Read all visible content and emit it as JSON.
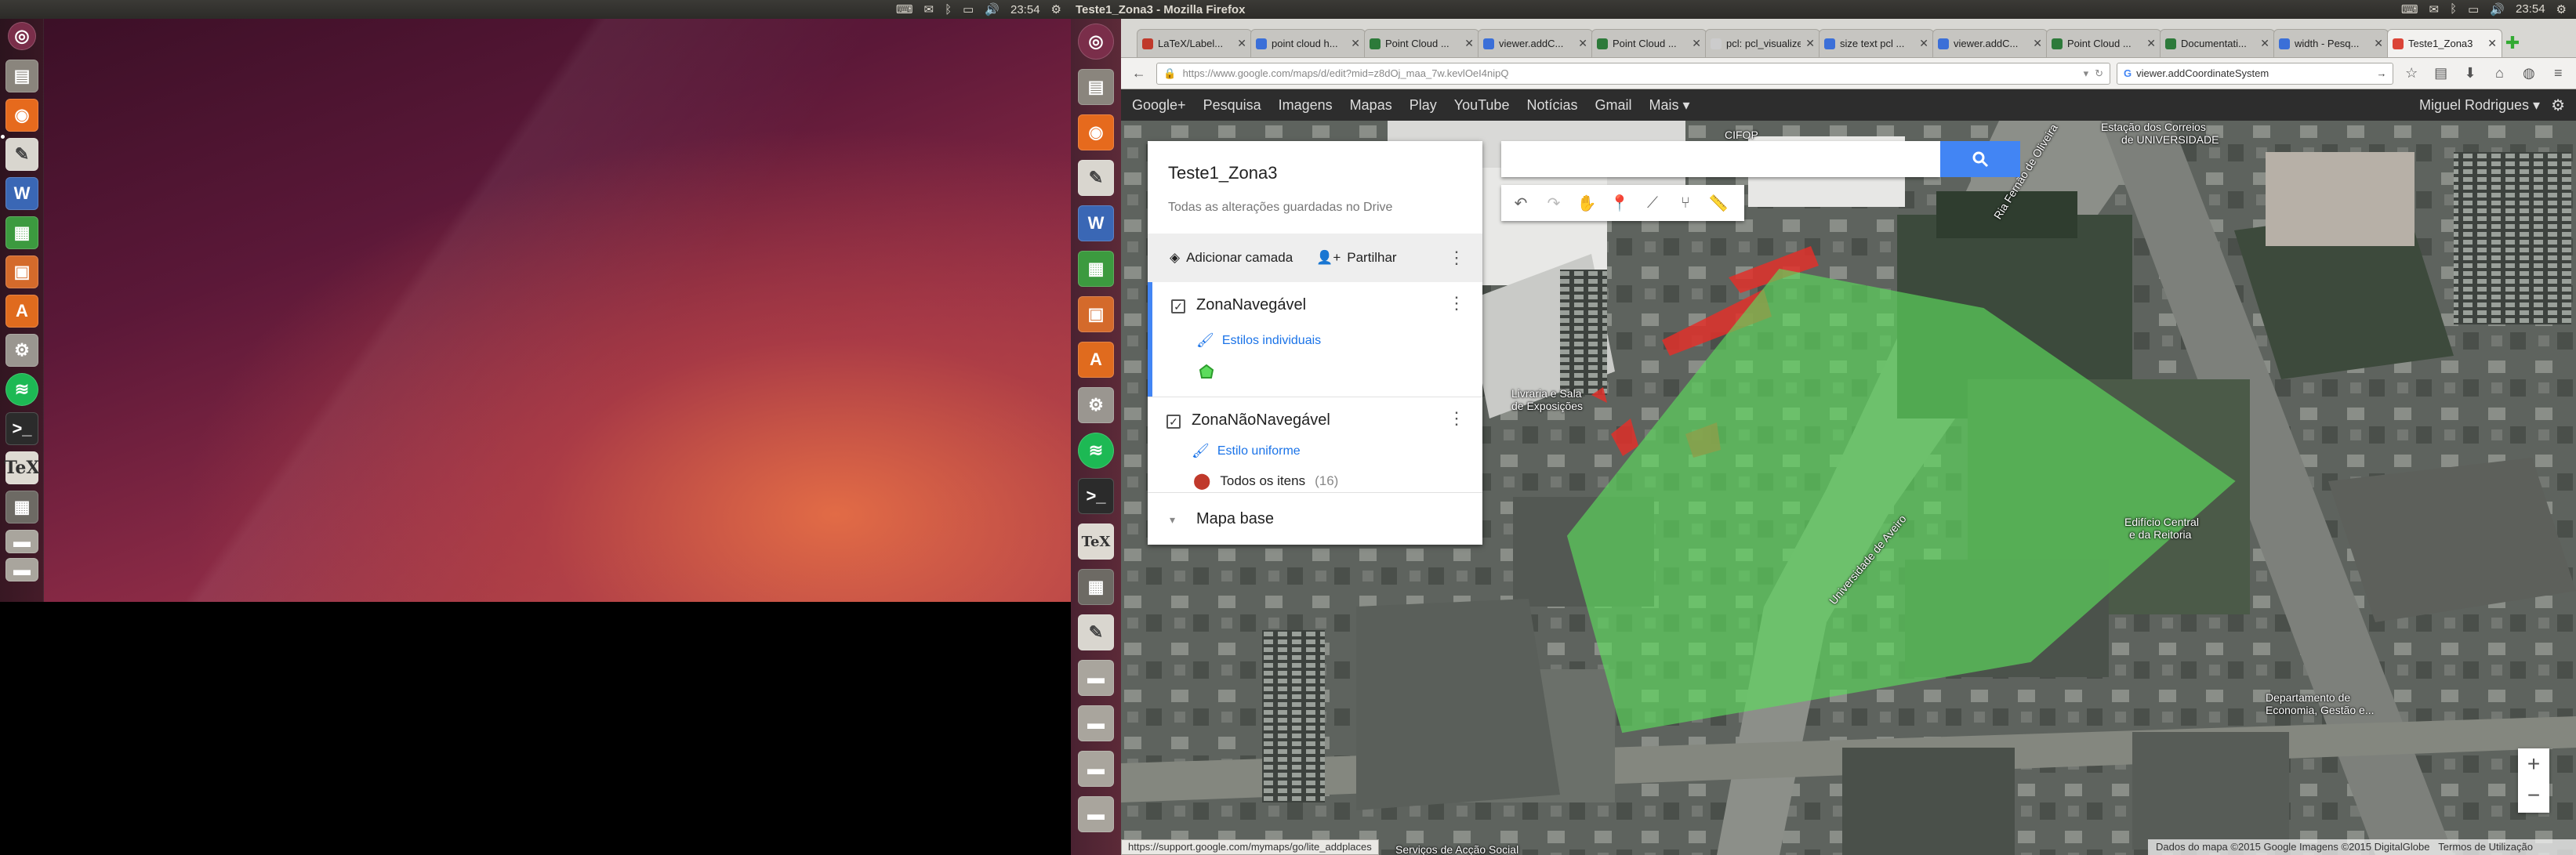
{
  "left_screen": {
    "clock": "23:54"
  },
  "right_screen": {
    "window_title": "Teste1_Zona3 - Mozilla Firefox",
    "clock": "23:54"
  },
  "tabs": [
    {
      "label": "LaTeX/Label...",
      "icon_color": "#c0392b"
    },
    {
      "label": "point cloud h...",
      "icon_color": "#3b6fd8"
    },
    {
      "label": "Point Cloud ...",
      "icon_color": "#2d7a3a"
    },
    {
      "label": "viewer.addC...",
      "icon_color": "#3b6fd8"
    },
    {
      "label": "Point Cloud ...",
      "icon_color": "#2d7a3a"
    },
    {
      "label": "pcl: pcl_visualize...",
      "icon_color": "#cccccc"
    },
    {
      "label": "size text pcl ...",
      "icon_color": "#3b6fd8"
    },
    {
      "label": "viewer.addC...",
      "icon_color": "#3b6fd8"
    },
    {
      "label": "Point Cloud ...",
      "icon_color": "#2d7a3a"
    },
    {
      "label": "Documentati...",
      "icon_color": "#2d7a3a"
    },
    {
      "label": "width - Pesq...",
      "icon_color": "#3b6fd8"
    },
    {
      "label": "Teste1_Zona3",
      "icon_color": "#db4437"
    }
  ],
  "navbar": {
    "url": "https://www.google.com/maps/d/edit?mid=z8dOj_maa_7w.kevlOeI4nipQ",
    "search": "viewer.addCoordinateSystem"
  },
  "google_bar": {
    "links": [
      "Google+",
      "Pesquisa",
      "Imagens",
      "Mapas",
      "Play",
      "YouTube",
      "Notícias",
      "Gmail",
      "Mais ▾"
    ],
    "user": "Miguel Rodrigues ▾"
  },
  "panel": {
    "title": "Teste1_Zona3",
    "subtitle": "Todas as alterações guardadas no Drive",
    "add_layer": "Adicionar camada",
    "share": "Partilhar",
    "layer1": {
      "name": "ZonaNavegável",
      "style": "Estilos individuais"
    },
    "layer2": {
      "name": "ZonaNãoNavegável",
      "style": "Estilo uniforme",
      "items_label": "Todos os itens",
      "items_count": "(16)"
    },
    "basemap": "Mapa base"
  },
  "map": {
    "labels": [
      "CIFOP",
      "Estação dos Correios",
      "de UNIVERSIDADE",
      "Livraria e Sala",
      "de Exposições",
      "Edifício Central",
      "e da Reitoria",
      "Universidade de Aveiro",
      "Departamento de",
      "Economia, Gestão e...",
      "Serviços de Acção Social",
      "Ria Fernão de Oliveira"
    ],
    "footer_data": "Dados do mapa ©2015 Google Imagens ©2015 DigitalGlobe",
    "footer_terms": "Termos de Utilização",
    "zoom_in": "+",
    "zoom_out": "−"
  },
  "status_url": "https://support.google.com/mymaps/go/lite_addplaces",
  "colors": {
    "navigable_polygon": "#5ddc5d",
    "non_navigable_polygon": "#e0302a",
    "accent": "#4285f4"
  }
}
